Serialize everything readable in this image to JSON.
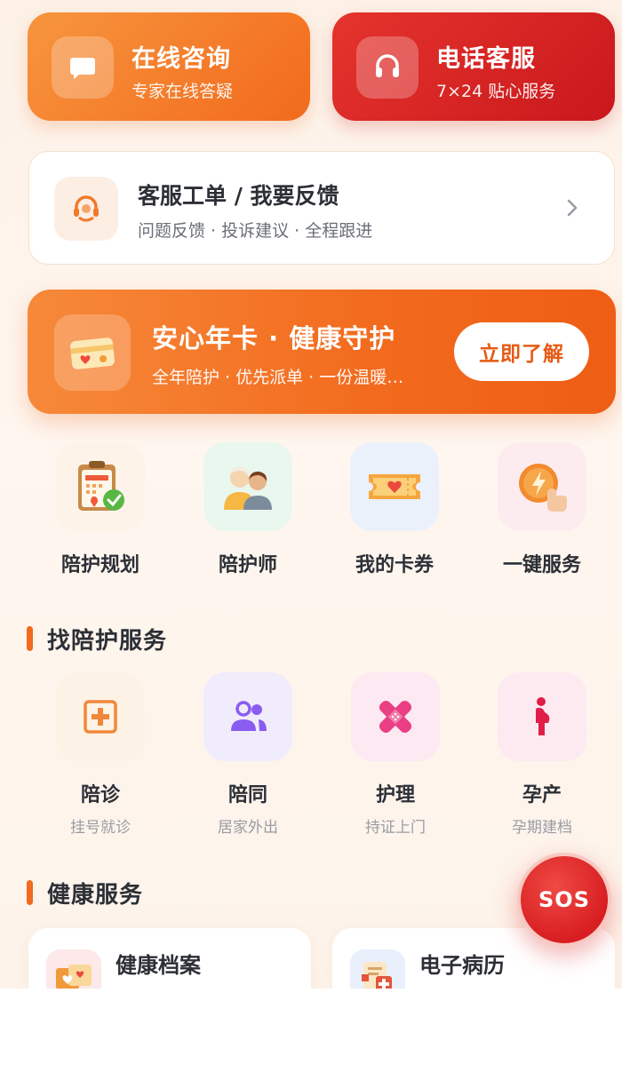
{
  "quick_actions": [
    {
      "title": "在线咨询",
      "subtitle": "专家在线答疑",
      "icon": "chat-bubble-icon"
    },
    {
      "title": "电话客服",
      "subtitle": "7×24 贴心服务",
      "icon": "headset-icon"
    }
  ],
  "ticket": {
    "title": "客服工单 / 我要反馈",
    "subtitle": "问题反馈 · 投诉建议 · 全程跟进",
    "icon": "support-agent-icon"
  },
  "promo": {
    "title": "安心年卡 · 健康守护",
    "subtitle": "全年陪护 · 优先派单 · 一份温暖…",
    "button_label": "立即了解",
    "icon": "card-icon"
  },
  "grid": [
    {
      "label": "陪护规划",
      "icon": "clipboard-calendar-icon"
    },
    {
      "label": "陪护师",
      "icon": "caregivers-icon"
    },
    {
      "label": "我的卡券",
      "icon": "coupon-ticket-icon"
    },
    {
      "label": "一键服务",
      "icon": "tap-lightning-icon"
    }
  ],
  "sections": {
    "find_service": "找陪护服务",
    "health_service": "健康服务"
  },
  "services": [
    {
      "label": "陪诊",
      "sub": "挂号就诊",
      "icon": "medical-cross-icon"
    },
    {
      "label": "陪同",
      "sub": "居家外出",
      "icon": "people-icon"
    },
    {
      "label": "护理",
      "sub": "持证上门",
      "icon": "bandage-icon"
    },
    {
      "label": "孕产",
      "sub": "孕期建档",
      "icon": "pregnant-icon"
    }
  ],
  "health_cards": [
    {
      "title": "健康档案",
      "subtitle": "",
      "icon": "health-record-icon"
    },
    {
      "title": "电子病历",
      "subtitle": "",
      "icon": "medical-record-icon"
    }
  ],
  "sos_label": "SOS",
  "colors": {
    "brand_orange": "#f26a1c",
    "brand_red": "#d81e22",
    "text_dark": "#2c2f36",
    "text_muted": "#9a9ca3"
  }
}
